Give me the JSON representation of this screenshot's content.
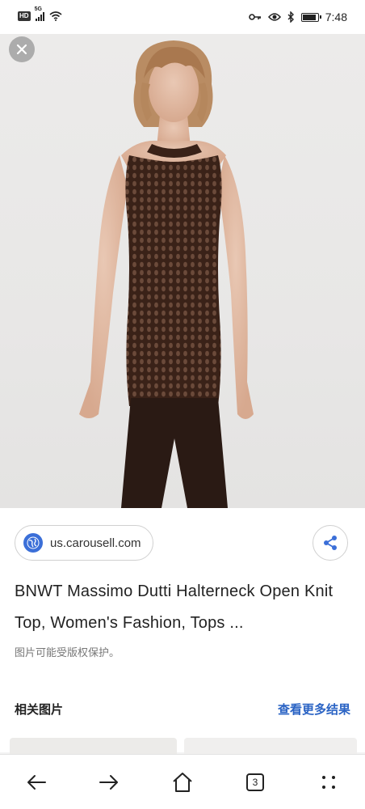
{
  "status_bar": {
    "badge": "HD",
    "network": "5G",
    "time": "7:48",
    "battery_level": 0.85,
    "icons": [
      "hd-icon",
      "signal-icon",
      "wifi-icon",
      "key-icon",
      "eye-icon",
      "bluetooth-icon",
      "battery-icon"
    ]
  },
  "image_viewer": {
    "close_icon": "close-icon",
    "image_subject": "model-in-brown-open-knit-top"
  },
  "result": {
    "source": "us.carousell.com",
    "title": "BNWT Massimo Dutti Halterneck Open Knit Top, Women's Fashion, Tops ...",
    "copyright_notice": "图片可能受版权保护。",
    "share_icon": "share-icon",
    "globe_icon": "globe-icon"
  },
  "related": {
    "label": "相关图片",
    "more_link": "查看更多结果"
  },
  "bottom_nav": {
    "tab_count": "3",
    "icons": [
      "back-arrow-icon",
      "forward-arrow-icon",
      "home-icon",
      "tabs-icon",
      "more-icon"
    ]
  },
  "colors": {
    "link": "#2a63c4",
    "knit_top": "#3a2218",
    "pants": "#2a1a14",
    "background": "#e9e8e7"
  }
}
